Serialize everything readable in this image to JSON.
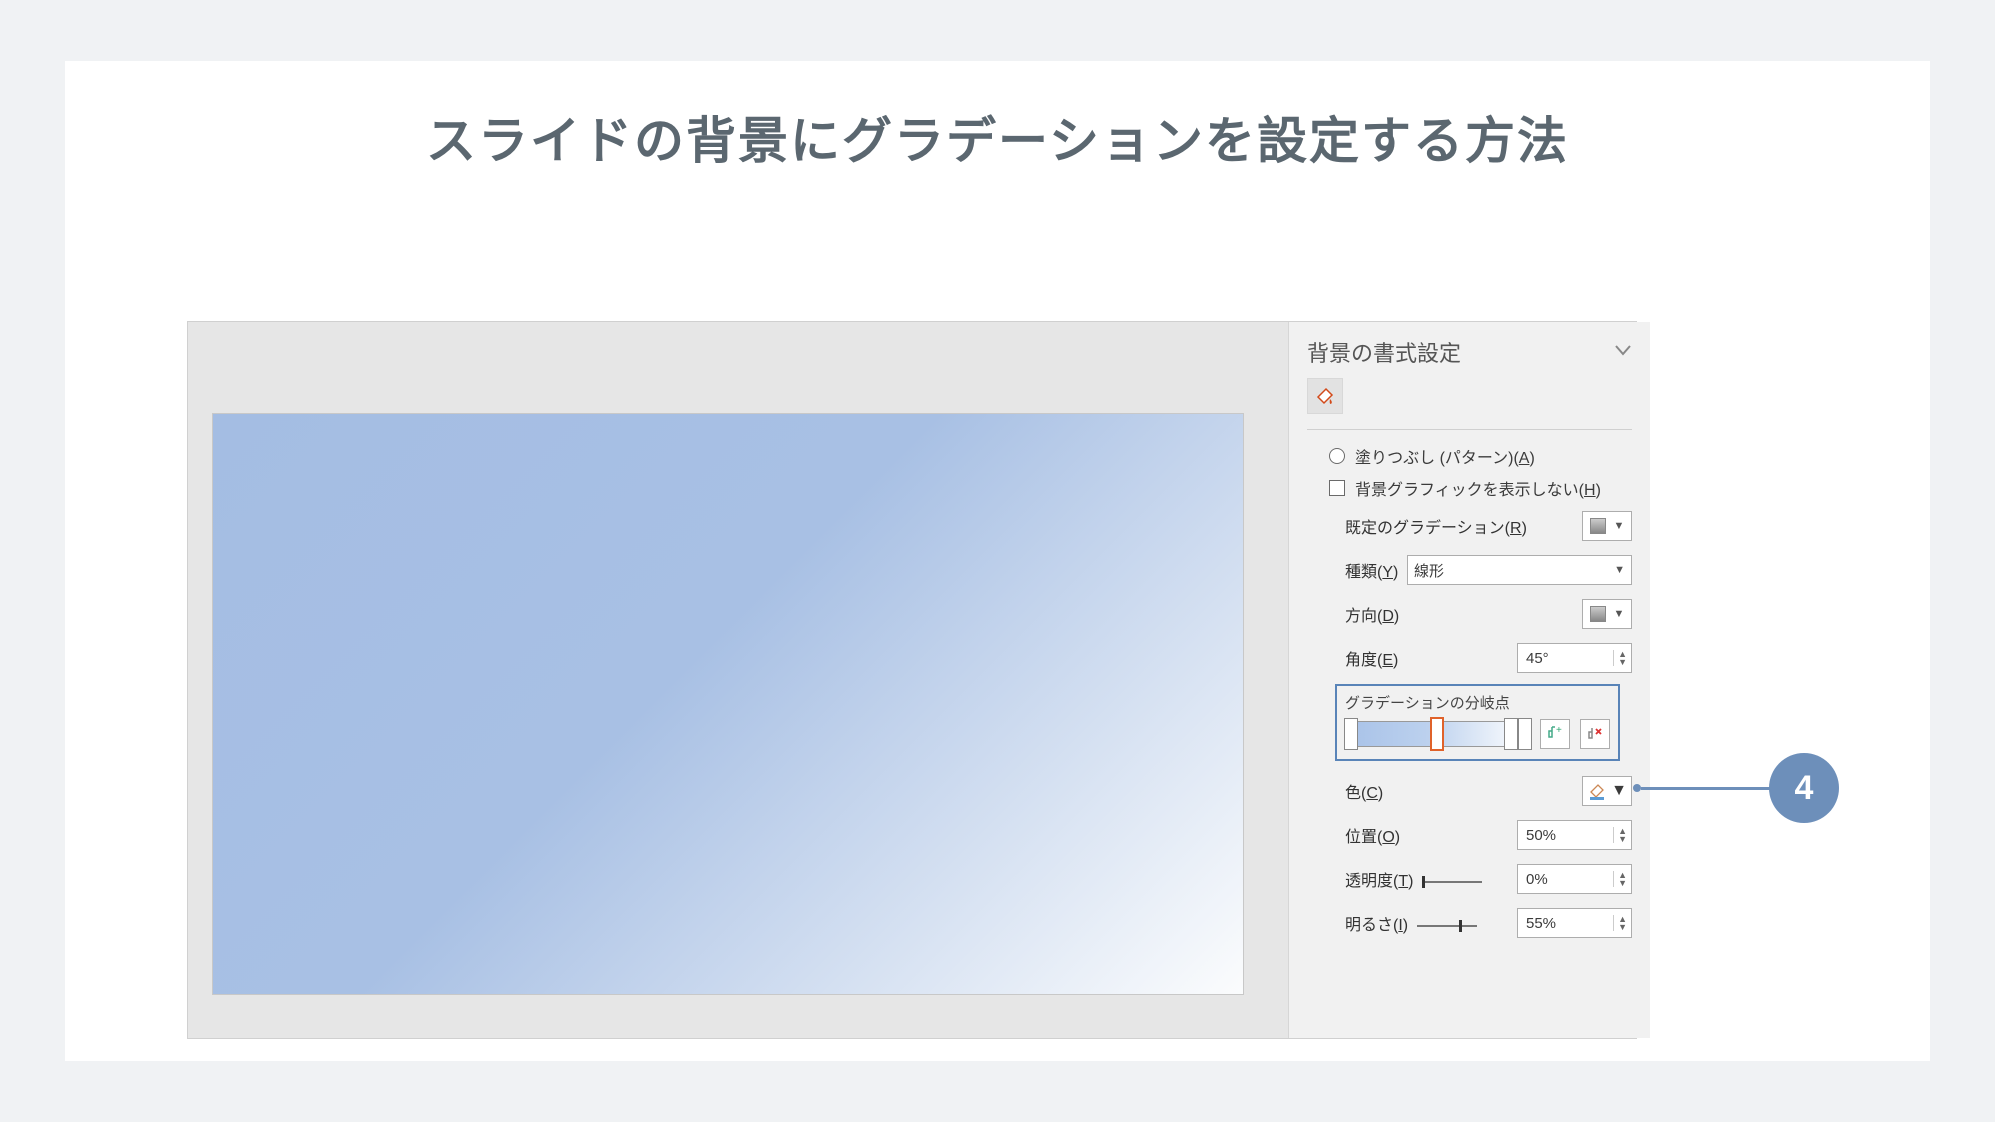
{
  "article_title": "スライドの背景にグラデーションを設定する方法",
  "panel": {
    "title": "背景の書式設定",
    "fill_pattern_label": "塗りつぶし (パターン)(",
    "fill_pattern_key": "A",
    "fill_pattern_close": ")",
    "hide_bg_graphics_label": "背景グラフィックを表示しない(",
    "hide_bg_graphics_key": "H",
    "hide_bg_graphics_close": ")",
    "preset_label": "既定のグラデーション(",
    "preset_key": "R",
    "preset_close": ")",
    "type_label": "種類(",
    "type_key": "Y",
    "type_close": ")",
    "type_value": "線形",
    "direction_label": "方向(",
    "direction_key": "D",
    "direction_close": ")",
    "angle_label": "角度(",
    "angle_key": "E",
    "angle_close": ")",
    "angle_value": "45°",
    "stops_label": "グラデーションの分岐点",
    "color_label": "色(",
    "color_key": "C",
    "color_close": ")",
    "position_label": "位置(",
    "position_key": "O",
    "position_close": ")",
    "position_value": "50%",
    "transparency_label": "透明度(",
    "transparency_key": "T",
    "transparency_close": ")",
    "transparency_value": "0%",
    "brightness_label": "明るさ(",
    "brightness_key": "I",
    "brightness_close": ")",
    "brightness_value": "55%"
  },
  "callout_number": "4"
}
